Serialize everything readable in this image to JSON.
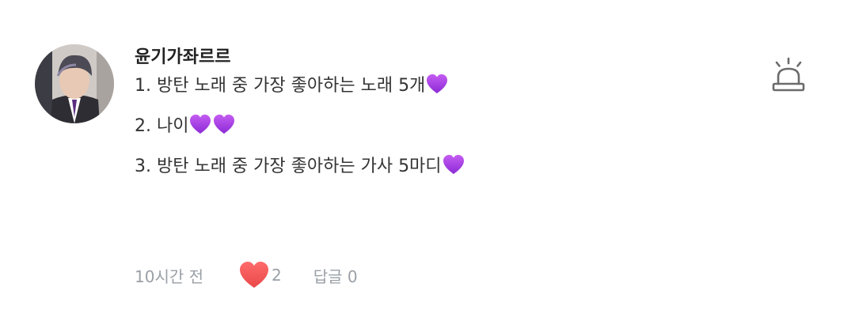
{
  "comment": {
    "author": "윤기가좌르르",
    "lines": [
      {
        "text": "1. 방탄 노래 중 가장 좋아하는 노래 5개",
        "emoji": [
          "purple-heart"
        ]
      },
      {
        "text": "2. 나이",
        "emoji": [
          "purple-heart",
          "purple-heart"
        ]
      },
      {
        "text": "3. 방탄 노래 중 가장 좋아하는 가사 5마디",
        "emoji": [
          "purple-heart"
        ]
      }
    ],
    "time": "10시간 전",
    "likes": "2",
    "reply_label": "답글 0"
  },
  "icons": {
    "avatar": "user-photo-avatar",
    "report": "siren-icon",
    "like": "red-heart-icon",
    "emoji": "purple-heart-icon"
  },
  "colors": {
    "like_heart": "#f25858",
    "emoji_heart": "#a13fe3",
    "meta_text": "#9aa0a6",
    "author_text": "#222222"
  }
}
